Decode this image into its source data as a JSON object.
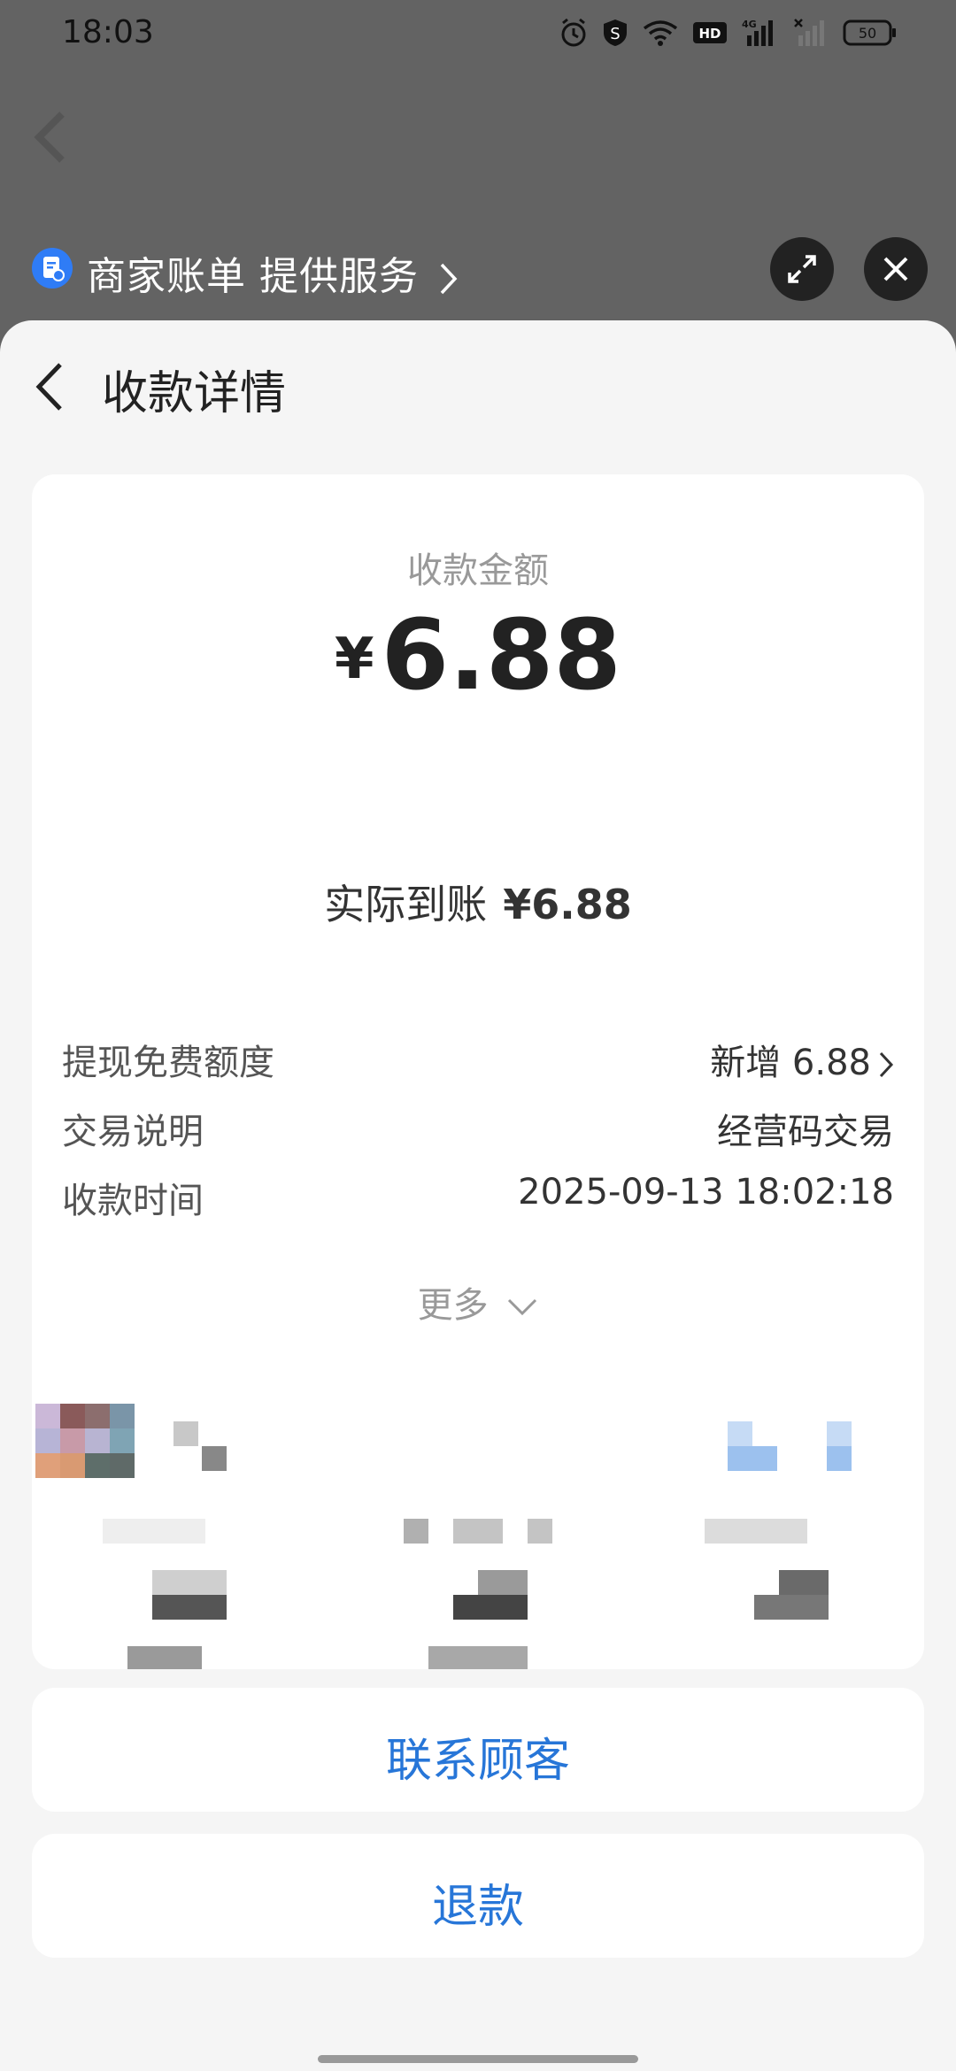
{
  "status_bar": {
    "time": "18:03",
    "battery": "50"
  },
  "mini_program": {
    "title": "商家账单 提供服务"
  },
  "header": {
    "title": "收款详情"
  },
  "payment": {
    "amount_label": "收款金额",
    "currency": "¥",
    "amount": "6.88",
    "actual_label": "实际到账",
    "actual_amount": "¥6.88"
  },
  "details": [
    {
      "label": "提现免费额度",
      "value": "新增 6.88"
    },
    {
      "label": "交易说明",
      "value": "经营码交易"
    },
    {
      "label": "收款时间",
      "value": "2025-09-13 18:02:18"
    }
  ],
  "more_label": "更多",
  "buttons": {
    "contact": "联系顾客",
    "refund": "退款"
  }
}
